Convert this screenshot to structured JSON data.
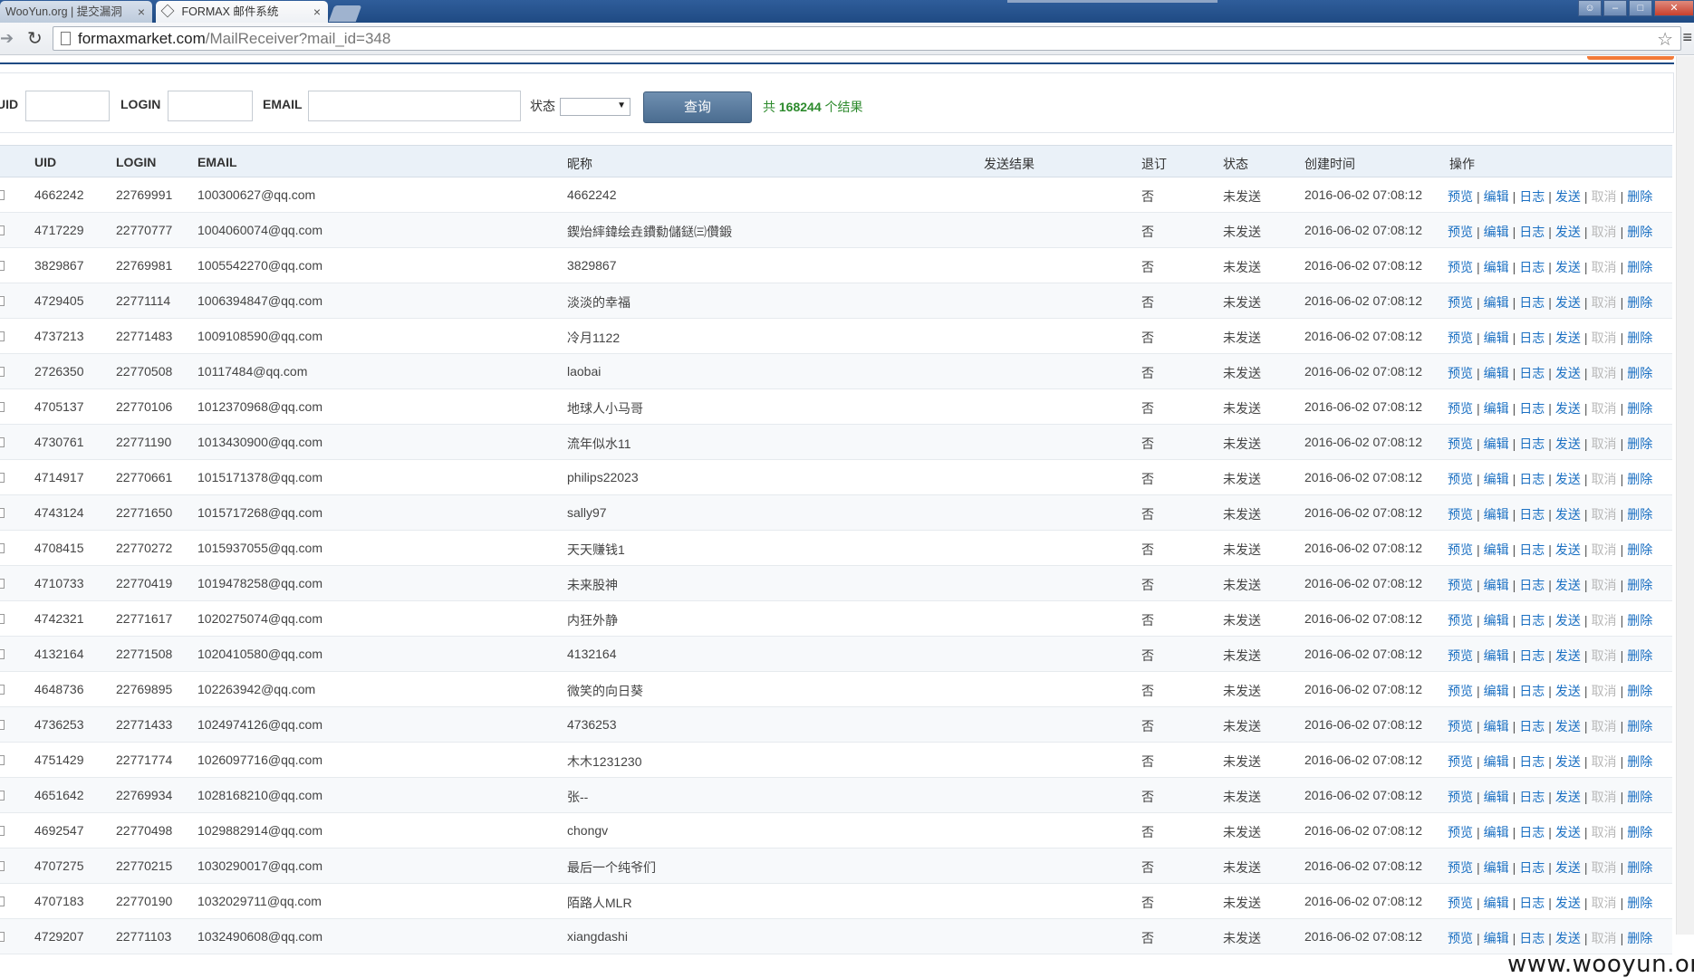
{
  "browser": {
    "tabs": [
      {
        "title": "WooYun.org | 提交漏洞",
        "active": false
      },
      {
        "title": "FORMAX 邮件系统",
        "active": true
      }
    ],
    "url_host": "formaxmarket.com",
    "url_path": "/MailReceiver?mail_id=348"
  },
  "search": {
    "uid_label": "UID",
    "login_label": "LOGIN",
    "email_label": "EMAIL",
    "status_label": "状态",
    "status_selected": "",
    "query_button": "查询",
    "result_prefix": "共",
    "result_count": "168244",
    "result_suffix": "个结果"
  },
  "table": {
    "columns": [
      "UID",
      "LOGIN",
      "EMAIL",
      "昵称",
      "发送结果",
      "退订",
      "状态",
      "创建时间",
      "操作"
    ],
    "actions": [
      "预览",
      "编辑",
      "日志",
      "发送",
      "取消",
      "删除"
    ],
    "rows": [
      {
        "uid": "4662242",
        "login": "22769991",
        "email": "100300627@qq.com",
        "nickname": "4662242",
        "result": "",
        "unsub": "否",
        "status": "未发送",
        "created": "2016-06-02 07:08:12"
      },
      {
        "uid": "4717229",
        "login": "22770777",
        "email": "1004060074@qq.com",
        "nickname": "鍥炲繂鍏绘垚鐨勬儲鎹㈢儹鍛",
        "result": "",
        "unsub": "否",
        "status": "未发送",
        "created": "2016-06-02 07:08:12"
      },
      {
        "uid": "3829867",
        "login": "22769981",
        "email": "1005542270@qq.com",
        "nickname": "3829867",
        "result": "",
        "unsub": "否",
        "status": "未发送",
        "created": "2016-06-02 07:08:12"
      },
      {
        "uid": "4729405",
        "login": "22771114",
        "email": "1006394847@qq.com",
        "nickname": "淡淡的幸福",
        "result": "",
        "unsub": "否",
        "status": "未发送",
        "created": "2016-06-02 07:08:12"
      },
      {
        "uid": "4737213",
        "login": "22771483",
        "email": "1009108590@qq.com",
        "nickname": "冷月1122",
        "result": "",
        "unsub": "否",
        "status": "未发送",
        "created": "2016-06-02 07:08:12"
      },
      {
        "uid": "2726350",
        "login": "22770508",
        "email": "10117484@qq.com",
        "nickname": "laobai",
        "result": "",
        "unsub": "否",
        "status": "未发送",
        "created": "2016-06-02 07:08:12"
      },
      {
        "uid": "4705137",
        "login": "22770106",
        "email": "1012370968@qq.com",
        "nickname": "地球人小马哥",
        "result": "",
        "unsub": "否",
        "status": "未发送",
        "created": "2016-06-02 07:08:12"
      },
      {
        "uid": "4730761",
        "login": "22771190",
        "email": "1013430900@qq.com",
        "nickname": "流年似水11",
        "result": "",
        "unsub": "否",
        "status": "未发送",
        "created": "2016-06-02 07:08:12"
      },
      {
        "uid": "4714917",
        "login": "22770661",
        "email": "1015171378@qq.com",
        "nickname": "philips22023",
        "result": "",
        "unsub": "否",
        "status": "未发送",
        "created": "2016-06-02 07:08:12"
      },
      {
        "uid": "4743124",
        "login": "22771650",
        "email": "1015717268@qq.com",
        "nickname": "sally97",
        "result": "",
        "unsub": "否",
        "status": "未发送",
        "created": "2016-06-02 07:08:12"
      },
      {
        "uid": "4708415",
        "login": "22770272",
        "email": "1015937055@qq.com",
        "nickname": "天天赚钱1",
        "result": "",
        "unsub": "否",
        "status": "未发送",
        "created": "2016-06-02 07:08:12"
      },
      {
        "uid": "4710733",
        "login": "22770419",
        "email": "1019478258@qq.com",
        "nickname": "未来股神",
        "result": "",
        "unsub": "否",
        "status": "未发送",
        "created": "2016-06-02 07:08:12"
      },
      {
        "uid": "4742321",
        "login": "22771617",
        "email": "1020275074@qq.com",
        "nickname": "内狂外静",
        "result": "",
        "unsub": "否",
        "status": "未发送",
        "created": "2016-06-02 07:08:12"
      },
      {
        "uid": "4132164",
        "login": "22771508",
        "email": "1020410580@qq.com",
        "nickname": "4132164",
        "result": "",
        "unsub": "否",
        "status": "未发送",
        "created": "2016-06-02 07:08:12"
      },
      {
        "uid": "4648736",
        "login": "22769895",
        "email": "102263942@qq.com",
        "nickname": "微笑的向日葵",
        "result": "",
        "unsub": "否",
        "status": "未发送",
        "created": "2016-06-02 07:08:12"
      },
      {
        "uid": "4736253",
        "login": "22771433",
        "email": "1024974126@qq.com",
        "nickname": "4736253",
        "result": "",
        "unsub": "否",
        "status": "未发送",
        "created": "2016-06-02 07:08:12"
      },
      {
        "uid": "4751429",
        "login": "22771774",
        "email": "1026097716@qq.com",
        "nickname": "木木1231230",
        "result": "",
        "unsub": "否",
        "status": "未发送",
        "created": "2016-06-02 07:08:12"
      },
      {
        "uid": "4651642",
        "login": "22769934",
        "email": "1028168210@qq.com",
        "nickname": "张--",
        "result": "",
        "unsub": "否",
        "status": "未发送",
        "created": "2016-06-02 07:08:12"
      },
      {
        "uid": "4692547",
        "login": "22770498",
        "email": "1029882914@qq.com",
        "nickname": "chongv",
        "result": "",
        "unsub": "否",
        "status": "未发送",
        "created": "2016-06-02 07:08:12"
      },
      {
        "uid": "4707275",
        "login": "22770215",
        "email": "1030290017@qq.com",
        "nickname": "最后一个纯爷们",
        "result": "",
        "unsub": "否",
        "status": "未发送",
        "created": "2016-06-02 07:08:12"
      },
      {
        "uid": "4707183",
        "login": "22770190",
        "email": "1032029711@qq.com",
        "nickname": "陌路人MLR",
        "result": "",
        "unsub": "否",
        "status": "未发送",
        "created": "2016-06-02 07:08:12"
      },
      {
        "uid": "4729207",
        "login": "22771103",
        "email": "1032490608@qq.com",
        "nickname": "xiangdashi",
        "result": "",
        "unsub": "否",
        "status": "未发送",
        "created": "2016-06-02 07:08:12"
      }
    ]
  },
  "watermark": "www.wooyun.org",
  "colors": {
    "link": "#1a6fc2",
    "disabled_link": "#b8b8b8",
    "header_bg": "#eaf1f8",
    "button": "#5b7ea3",
    "count": "#2c8a2c"
  }
}
